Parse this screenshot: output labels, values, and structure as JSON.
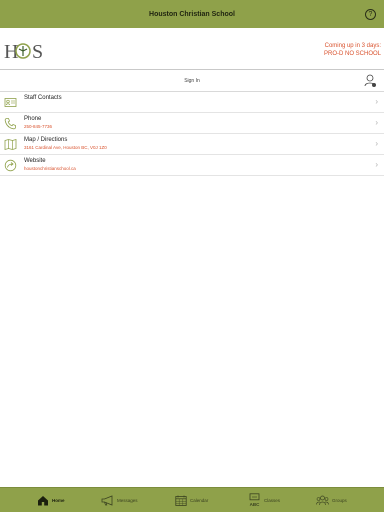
{
  "header": {
    "title": "Houston Christian School",
    "help_icon": "question-icon"
  },
  "brand": {
    "logo_text": "HCS",
    "notice_line1": "Coming up in 3 days:",
    "notice_line2": "PRO-D NO SCHOOL"
  },
  "signin": {
    "label": "Sign In",
    "icon": "user-add-icon"
  },
  "list": {
    "items": [
      {
        "title": "Staff Contacts",
        "subtitle": "",
        "icon": "contact-card-icon"
      },
      {
        "title": "Phone",
        "subtitle": "250-845-7736",
        "icon": "phone-icon"
      },
      {
        "title": "Map / Directions",
        "subtitle": "3161 Cardinal Ave, Houston BC, V0J 1Z0",
        "icon": "map-icon"
      },
      {
        "title": "Website",
        "subtitle": "houstonchristianschool.ca",
        "icon": "share-arrow-icon"
      }
    ]
  },
  "tabs": [
    {
      "label": "Home",
      "icon": "home-icon",
      "active": true
    },
    {
      "label": "Messages",
      "icon": "megaphone-icon",
      "active": false
    },
    {
      "label": "Calendar",
      "icon": "calendar-icon",
      "active": false
    },
    {
      "label": "Classes",
      "icon": "classes-icon",
      "active": false,
      "icon_text": "ABC"
    },
    {
      "label": "Groups",
      "icon": "groups-icon",
      "active": false
    }
  ],
  "colors": {
    "bar": "#8fa14a",
    "accent": "#d9512c"
  }
}
